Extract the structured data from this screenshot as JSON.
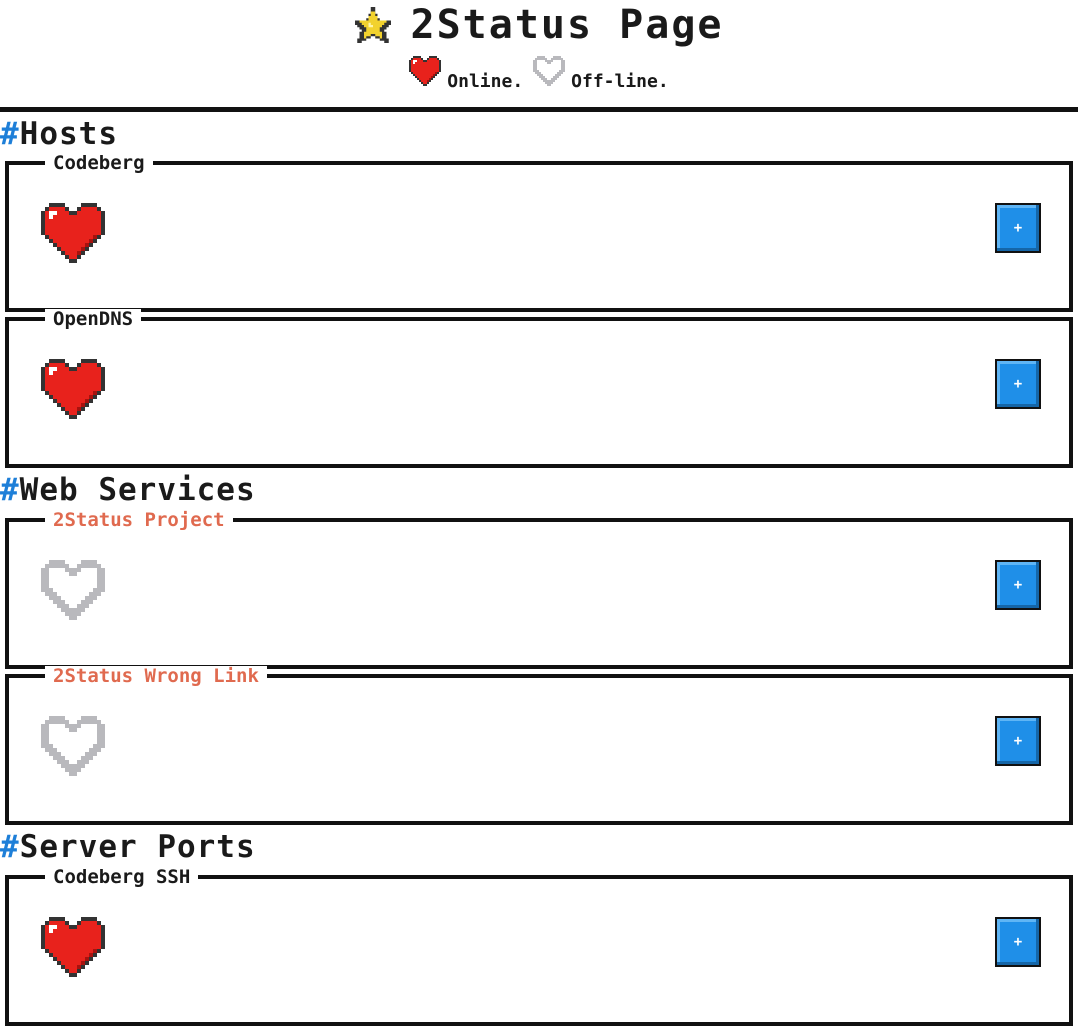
{
  "header": {
    "title": "2Status Page",
    "title_icon": "star-icon",
    "legend": {
      "online_label": "Online.",
      "offline_label": "Off-line."
    }
  },
  "colors": {
    "online_heart": "#e8221c",
    "offline_heart": "#b9b9bd",
    "accent": "#1e7fd8",
    "offline_text": "#e06a4f",
    "button": "#1f8fe8"
  },
  "sections": [
    {
      "title": "Hosts",
      "items": [
        {
          "name": "Codeberg",
          "status": "online",
          "button_label": "+"
        },
        {
          "name": "OpenDNS",
          "status": "online",
          "button_label": "+"
        }
      ]
    },
    {
      "title": "Web Services",
      "items": [
        {
          "name": "2Status Project",
          "status": "offline",
          "button_label": "+"
        },
        {
          "name": "2Status Wrong Link",
          "status": "offline",
          "button_label": "+"
        }
      ]
    },
    {
      "title": "Server Ports",
      "items": [
        {
          "name": "Codeberg SSH",
          "status": "online",
          "button_label": "+"
        }
      ]
    }
  ],
  "hash_symbol": "#"
}
